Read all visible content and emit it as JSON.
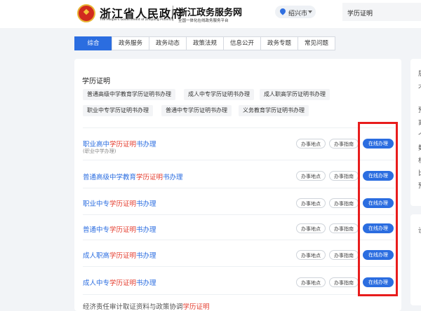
{
  "header": {
    "gov_title": "浙江省人民政府",
    "gov_en": "The People's Government of Zhejiang Province",
    "site_title": "浙江政务服务网",
    "site_sub": "全国一体化在线政务服务平台",
    "location": "绍兴市",
    "search_value": "学历证明"
  },
  "tabs": [
    "综合",
    "政务服务",
    "政务动态",
    "政策法规",
    "信息公开",
    "政务专题",
    "常见问题"
  ],
  "section": {
    "title": "学历证明",
    "chips": [
      "普通高级中学教育学历证明书办理",
      "成人中专学历证明书办理",
      "成人职高学历证明书办理",
      "职业中专学历证明书办理",
      "普通中专学历证明书办理",
      "义务教育学历证明书办理"
    ]
  },
  "buttons": {
    "location": "办事地点",
    "guide": "办事指南",
    "online": "在线办理"
  },
  "results": [
    {
      "pre": "职业高中",
      "hl": "学历证明",
      "post": "书办理",
      "sub": "(职业中学办理)"
    },
    {
      "pre": "普通高级中学教育",
      "hl": "学历证明",
      "post": "书办理"
    },
    {
      "pre": "职业中专",
      "hl": "学历证明",
      "post": "书办理"
    },
    {
      "pre": "普通中专",
      "hl": "学历证明",
      "post": "书办理"
    },
    {
      "pre": "成人职高",
      "hl": "学历证明",
      "post": "书办理"
    },
    {
      "pre": "成人中专",
      "hl": "学历证明",
      "post": "书办理"
    },
    {
      "pre": "经济责任审计取证资料与政策协调",
      "hl": "学历证明",
      "post": ""
    }
  ],
  "right_panel": {
    "chars": [
      "层",
      "不",
      "预",
      "离",
      "个",
      "数",
      "根",
      "比",
      "预"
    ],
    "char2": "设"
  },
  "colors": {
    "accent": "#2b6de0",
    "highlight": "#e43b2c",
    "annotation": "#e81c1c"
  }
}
